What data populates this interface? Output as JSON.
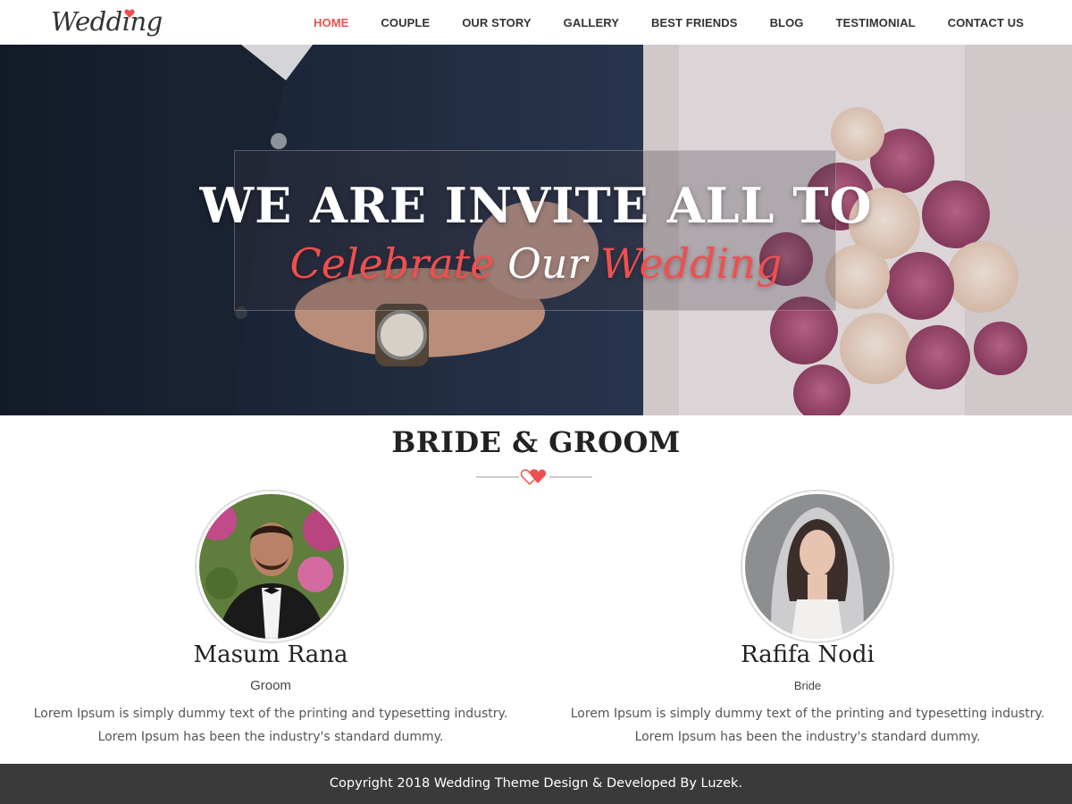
{
  "header": {
    "logo_text": "Wedding",
    "nav": [
      {
        "label": "HOME",
        "active": true
      },
      {
        "label": "COUPLE"
      },
      {
        "label": "OUR STORY"
      },
      {
        "label": "GALLERY"
      },
      {
        "label": "BEST FRIENDS"
      },
      {
        "label": "BLOG"
      },
      {
        "label": "TESTIMONIAL"
      },
      {
        "label": "CONTACT US"
      }
    ]
  },
  "hero": {
    "title": "WE ARE INVITE ALL TO",
    "subtitle_part1": "Celebrate ",
    "subtitle_part2": "Our ",
    "subtitle_part3": "Wedding"
  },
  "couple": {
    "section_title": "BRIDE & GROOM",
    "groom": {
      "name": "Masum Rana",
      "role": "Groom",
      "desc_line1": "Lorem Ipsum is simply dummy text of the printing and typesetting industry.",
      "desc_line2": "Lorem Ipsum has been the industry's standard dummy."
    },
    "bride": {
      "name": "Rafifa Nodi",
      "role": "Bride",
      "desc_line1": "Lorem Ipsum is simply dummy text of the printing and typesetting industry.",
      "desc_line2": "Lorem Ipsum has been the industry's standard dummy."
    }
  },
  "footer": {
    "copyright": "Copyright 2018 Wedding Theme Design & Developed By Luzek."
  },
  "colors": {
    "accent": "#ef4f4f",
    "text_dark": "#222222",
    "footer_bg": "#3a3a3a"
  },
  "icons": {
    "logo_heart": "heart-icon",
    "divider": "double-heart-icon"
  }
}
